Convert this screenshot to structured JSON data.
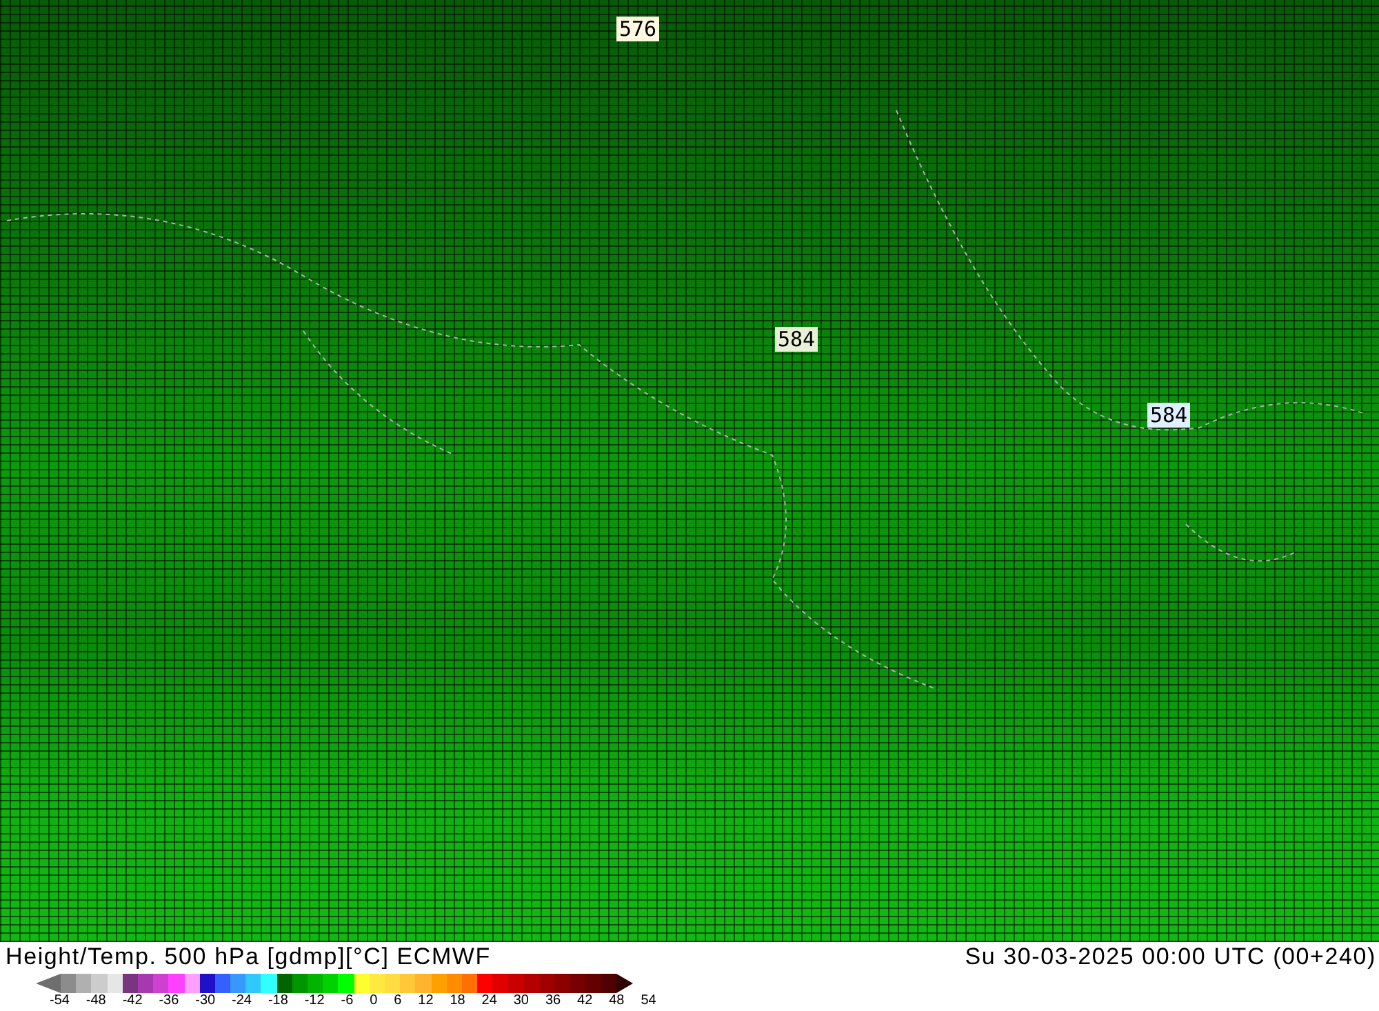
{
  "map": {
    "contour_labels": [
      {
        "text": "576",
        "color": "#fff8e0"
      },
      {
        "text": "584",
        "color": "#e8f0d8"
      },
      {
        "text": "584",
        "color": "#e0f0ff"
      }
    ]
  },
  "footer": {
    "title": "Height/Temp. 500 hPa [gdmp][°C] ECMWF",
    "valid_time": "Su 30-03-2025 00:00 UTC (00+240)"
  },
  "colorbar": {
    "swatches": [
      {
        "kind": "arrow-left",
        "color": "#6e6e6e"
      },
      {
        "kind": "swatch",
        "color": "#8c8c8c"
      },
      {
        "kind": "swatch",
        "color": "#b0b0b0"
      },
      {
        "kind": "swatch",
        "color": "#cccccc"
      },
      {
        "kind": "swatch",
        "color": "#e6e6e6"
      },
      {
        "kind": "swatch",
        "color": "#7a3580"
      },
      {
        "kind": "swatch",
        "color": "#a838b0"
      },
      {
        "kind": "swatch",
        "color": "#d040d0"
      },
      {
        "kind": "swatch",
        "color": "#ff40ff"
      },
      {
        "kind": "swatch",
        "color": "#ffa0ff"
      },
      {
        "kind": "swatch",
        "color": "#2010c8"
      },
      {
        "kind": "swatch",
        "color": "#3460ff"
      },
      {
        "kind": "swatch",
        "color": "#3898ff"
      },
      {
        "kind": "swatch",
        "color": "#30c8ff"
      },
      {
        "kind": "swatch",
        "color": "#30ffff"
      },
      {
        "kind": "swatch",
        "color": "#006400"
      },
      {
        "kind": "swatch",
        "color": "#009600"
      },
      {
        "kind": "swatch",
        "color": "#00b400"
      },
      {
        "kind": "swatch",
        "color": "#00d200"
      },
      {
        "kind": "swatch",
        "color": "#00ff00"
      },
      {
        "kind": "swatch",
        "color": "#ffff30"
      },
      {
        "kind": "swatch",
        "color": "#ffe840"
      },
      {
        "kind": "swatch",
        "color": "#ffdc40"
      },
      {
        "kind": "swatch",
        "color": "#ffc838"
      },
      {
        "kind": "swatch",
        "color": "#ffb430"
      },
      {
        "kind": "swatch",
        "color": "#ffa000"
      },
      {
        "kind": "swatch",
        "color": "#ff8c00"
      },
      {
        "kind": "swatch",
        "color": "#ff7000"
      },
      {
        "kind": "swatch",
        "color": "#ff0000"
      },
      {
        "kind": "swatch",
        "color": "#e00000"
      },
      {
        "kind": "swatch",
        "color": "#c80000"
      },
      {
        "kind": "swatch",
        "color": "#b40000"
      },
      {
        "kind": "swatch",
        "color": "#a00000"
      },
      {
        "kind": "swatch",
        "color": "#8c0000"
      },
      {
        "kind": "swatch",
        "color": "#780000"
      },
      {
        "kind": "swatch",
        "color": "#640000"
      },
      {
        "kind": "swatch",
        "color": "#500000"
      },
      {
        "kind": "arrow-right",
        "color": "#300000"
      }
    ],
    "ticks": [
      "-54",
      "-48",
      "-42",
      "-36",
      "-30",
      "-24",
      "-18",
      "-12",
      "-6",
      "0",
      "6",
      "12",
      "18",
      "24",
      "30",
      "36",
      "42",
      "48",
      "54"
    ]
  }
}
